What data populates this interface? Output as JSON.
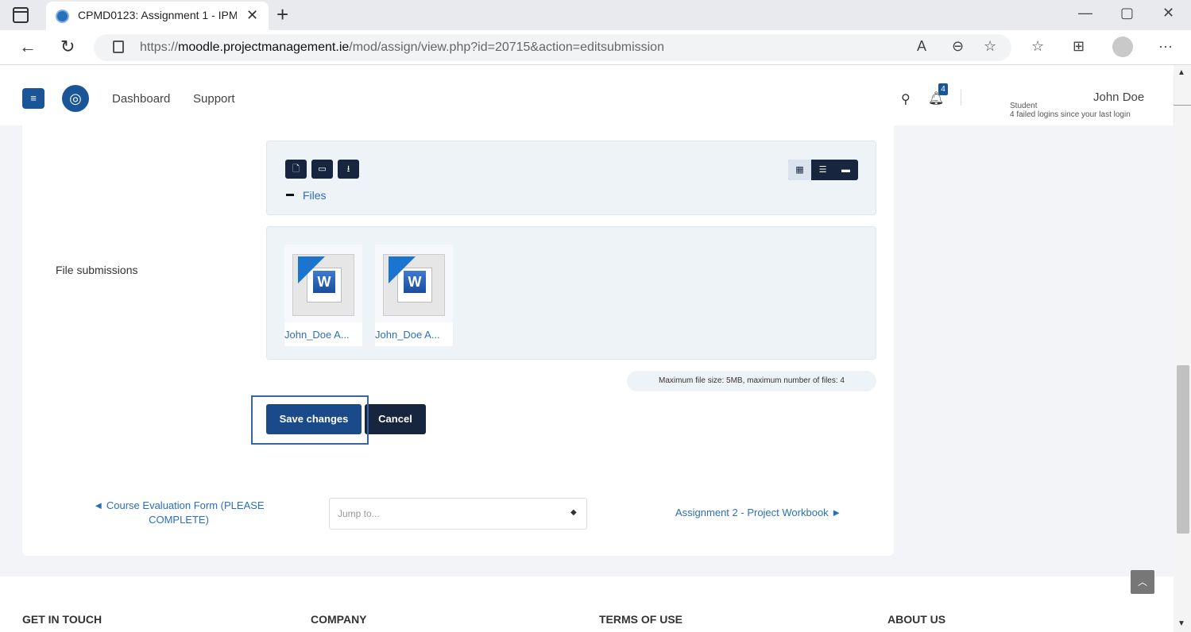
{
  "browser": {
    "tab_title": "CPMD0123: Assignment 1 - IPM/",
    "tab_close": "✕",
    "new_tab": "+",
    "url_prefix": "https://",
    "url_domain": "moodle.projectmanagement.ie",
    "url_path": "/mod/assign/view.php?id=20715&action=editsubmission",
    "window_controls": [
      "—",
      "▢",
      "✕"
    ]
  },
  "header": {
    "nav": [
      "Dashboard",
      "Support"
    ],
    "notification_count": "4",
    "user_name": "John Doe",
    "user_role": "Student",
    "failed_logins": "4 failed logins since your last login"
  },
  "filemanager": {
    "path_label": "Files",
    "field_label": "File submissions",
    "files": [
      "John_Doe A...",
      "John_Doe A..."
    ],
    "max_note": "Maximum file size: 5MB, maximum number of files: 4"
  },
  "actions": {
    "save": "Save changes",
    "cancel": "Cancel"
  },
  "navigation": {
    "prev": "◄ Course Evaluation Form (PLEASE COMPLETE)",
    "jump_placeholder": "Jump to...",
    "next": "Assignment 2 - Project Workbook ►"
  },
  "footer": {
    "columns": [
      "GET IN TOUCH",
      "COMPANY",
      "TERMS OF USE",
      "ABOUT US"
    ]
  },
  "colors": {
    "brand": "#1a5597",
    "dark_button": "#17253f",
    "link": "#2a6fba"
  }
}
